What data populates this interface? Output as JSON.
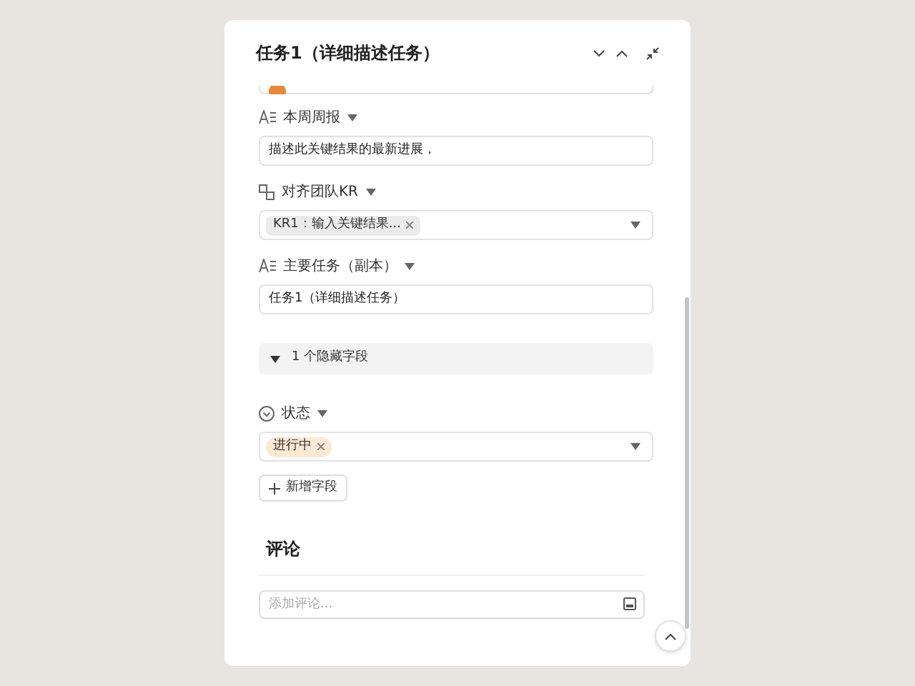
{
  "panel": {
    "title": "任务1（详细描述任务）"
  },
  "fields": [
    {
      "kind": "text",
      "label": "本周周报",
      "value": "描述此关键结果的最新进展，"
    },
    {
      "kind": "relation",
      "label": "对齐团队KR",
      "tags": [
        {
          "text": "KR1：输入关键结果...",
          "color": "#ebebeb"
        }
      ]
    },
    {
      "kind": "text",
      "label": "主要任务（副本）",
      "value": "任务1（详细描述任务）"
    },
    {
      "kind": "hidden",
      "label": "1 个隐藏字段",
      "expanded": false
    },
    {
      "kind": "status",
      "label": "状态",
      "tags": [
        {
          "text": "进行中",
          "color": "#fde9d3"
        }
      ]
    }
  ],
  "add_field": "新增字段",
  "comments": {
    "title": "评论",
    "placeholder": "添加评论..."
  }
}
